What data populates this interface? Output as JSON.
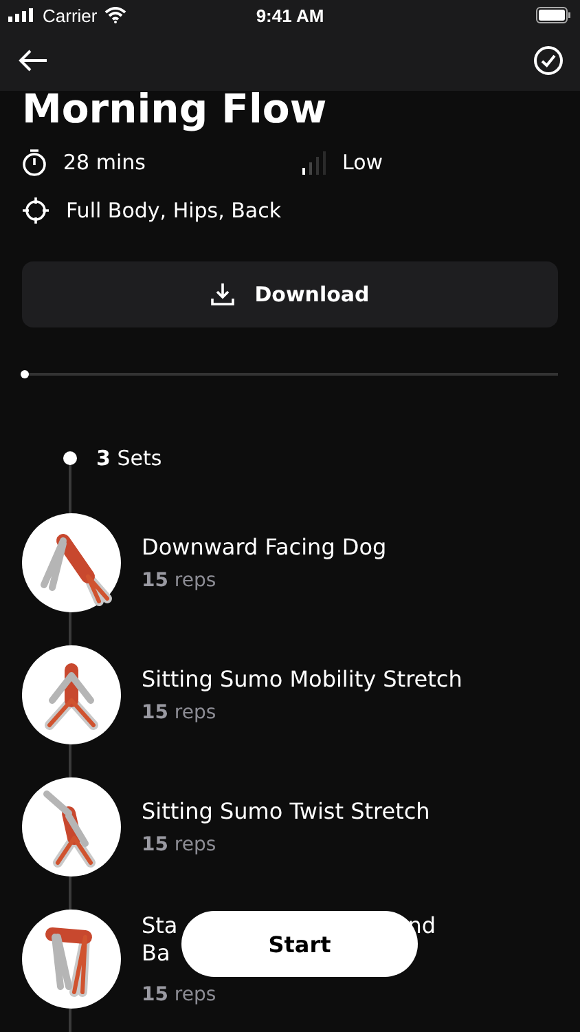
{
  "status_bar": {
    "carrier": "Carrier",
    "time": "9:41 AM"
  },
  "workout": {
    "title": "Morning Flow",
    "duration": "28 mins",
    "intensity": "Low",
    "focus": "Full Body, Hips, Back"
  },
  "download_button": {
    "label": "Download"
  },
  "progress": {
    "level": 0
  },
  "set_header": {
    "label": "**3** Sets"
  },
  "exercises": [
    {
      "title_lines": [
        [
          "Downward Facing Dog"
        ]
      ],
      "reps": "**15** reps"
    },
    {
      "title_lines": [
        [
          "Sitting Sumo Mobility Stretch"
        ]
      ],
      "reps": "**15** reps"
    },
    {
      "title_lines": [
        [
          "Sitting Sumo Twist Stretch"
        ]
      ],
      "reps": "**15** reps"
    },
    {
      "title_lines": [
        [
          "Sta",
          "nd"
        ],
        [
          "Ba"
        ]
      ],
      "reps": "**15** reps"
    }
  ],
  "start_button": {
    "label": "Start"
  }
}
